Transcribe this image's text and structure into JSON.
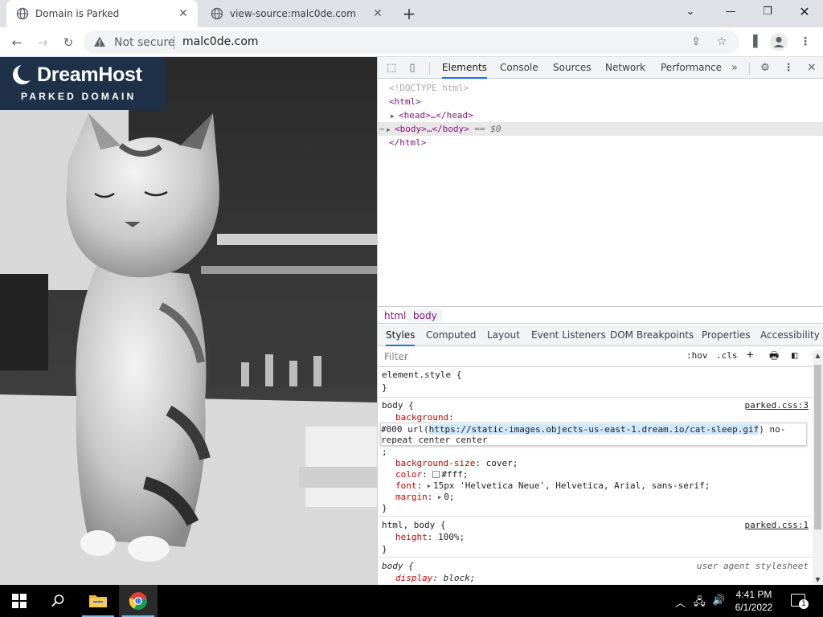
{
  "browser": {
    "tabs": [
      {
        "title": "Domain is Parked",
        "active": true
      },
      {
        "title": "view-source:malc0de.com",
        "active": false
      }
    ],
    "address": {
      "security_label": "Not secure",
      "url": "malc0de.com"
    }
  },
  "page": {
    "logo_brand": "DreamHost",
    "logo_sub": "PARKED DOMAIN"
  },
  "devtools": {
    "tabs": [
      "Elements",
      "Console",
      "Sources",
      "Network",
      "Performance"
    ],
    "dom": {
      "doctype": "<!DOCTYPE html>",
      "html_open": "<html>",
      "head": "<head>…</head>",
      "body": "<body>…</body>",
      "body_marker": "== $0",
      "html_close": "</html>"
    },
    "breadcrumbs": [
      "html",
      "body"
    ],
    "subtabs": [
      "Styles",
      "Computed",
      "Layout",
      "Event Listeners",
      "DOM Breakpoints",
      "Properties",
      "Accessibility"
    ],
    "filter": {
      "placeholder": "Filter",
      "hov": ":hov",
      "cls": ".cls"
    },
    "styles": {
      "element_style": "element.style {",
      "close_brace": "}",
      "body_selector": "body {",
      "body_source": "parked.css:3",
      "bg_prop": "background",
      "bg_prefix": "#000 url(",
      "bg_url": "https://static-images.objects-us-east-1.dream.io/cat-sleep.gif",
      "bg_suffix": ") no-",
      "bg_line2": "repeat center center",
      "semicolon": ";",
      "bgsize_prop": "background-size",
      "bgsize_val": "cover;",
      "color_prop": "color",
      "color_val": "#fff;",
      "font_prop": "font",
      "font_val": "15px 'Helvetica Neue', Helvetica, Arial, sans-serif;",
      "margin_prop": "margin",
      "margin_val": "0;",
      "htmlbody_selector": "html, body {",
      "htmlbody_source": "parked.css:1",
      "height_prop": "height",
      "height_val": "100%;",
      "ua_selector": "body {",
      "ua_source": "user agent stylesheet",
      "display_prop": "display",
      "display_val": "block;"
    }
  },
  "taskbar": {
    "time": "4:41 PM",
    "date": "6/1/2022",
    "notification_count": "1"
  },
  "colors": {
    "accent": "#1a73e8",
    "tag": "#881280",
    "css_prop": "#c80000",
    "dreamhost_panel": "#1f3148"
  }
}
